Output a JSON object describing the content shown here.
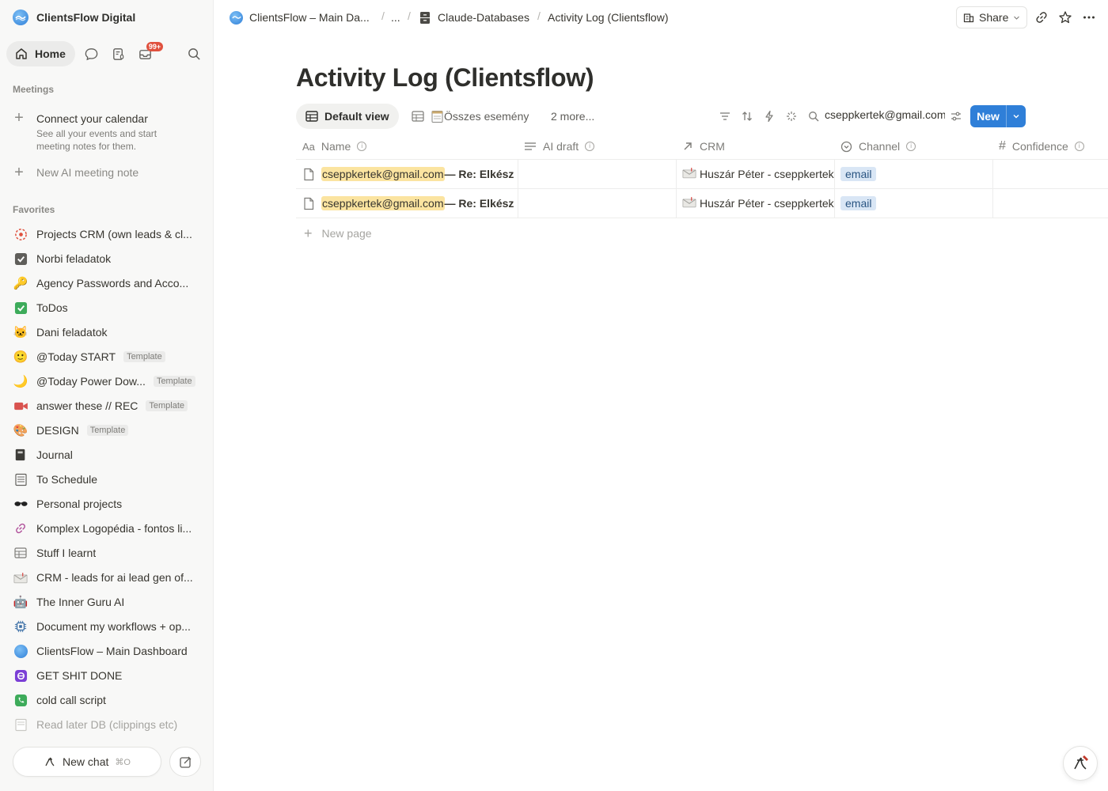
{
  "workspace": {
    "name": "ClientsFlow Digital"
  },
  "nav": {
    "home_label": "Home",
    "inbox_badge": "99+"
  },
  "meetings": {
    "section_label": "Meetings",
    "connect_title": "Connect your calendar",
    "connect_sub": "See all your events and start meeting notes for them.",
    "new_note": "New AI meeting note"
  },
  "favorites": {
    "section_label": "Favorites",
    "items": [
      {
        "label": "Projects CRM (own leads & cl...",
        "icon": "target-icon",
        "template": ""
      },
      {
        "label": "Norbi feladatok",
        "icon": "checkbox-icon",
        "template": ""
      },
      {
        "label": "Agency Passwords and Acco...",
        "icon": "key-icon",
        "template": ""
      },
      {
        "label": "ToDos",
        "icon": "check-mark-icon",
        "template": ""
      },
      {
        "label": "Dani feladatok",
        "icon": "cat-icon",
        "template": ""
      },
      {
        "label": "@Today START",
        "icon": "smile-icon",
        "template": "Template"
      },
      {
        "label": "@Today Power Dow...",
        "icon": "moon-icon",
        "template": "Template"
      },
      {
        "label": "answer these // REC",
        "icon": "video-camera-icon",
        "template": "Template"
      },
      {
        "label": "DESIGN",
        "icon": "palette-icon",
        "template": "Template"
      },
      {
        "label": "Journal",
        "icon": "notebook-icon",
        "template": ""
      },
      {
        "label": "To Schedule",
        "icon": "ledger-icon",
        "template": ""
      },
      {
        "label": "Personal projects",
        "icon": "sunglasses-icon",
        "template": ""
      },
      {
        "label": "Komplex Logopédia - fontos li...",
        "icon": "link-icon",
        "template": ""
      },
      {
        "label": "Stuff I learnt",
        "icon": "table-icon",
        "template": ""
      },
      {
        "label": "CRM - leads for ai lead gen of...",
        "icon": "envelope-icon",
        "template": ""
      },
      {
        "label": "The Inner Guru AI",
        "icon": "robot-icon",
        "template": ""
      },
      {
        "label": "Document my workflows + op...",
        "icon": "chip-icon",
        "template": ""
      },
      {
        "label": "ClientsFlow – Main Dashboard",
        "icon": "clientsflow-logo-icon",
        "template": ""
      },
      {
        "label": "GET SHIT DONE",
        "icon": "purple-badge-icon",
        "template": ""
      },
      {
        "label": "cold call script",
        "icon": "phone-icon",
        "template": ""
      },
      {
        "label": "Read later DB (clippings etc)",
        "icon": "document-icon",
        "template": ""
      }
    ]
  },
  "bottom": {
    "new_chat": "New chat",
    "shortcut": "⌘O"
  },
  "breadcrumbs": {
    "root": "ClientsFlow – Main Da...",
    "ellipsis": "...",
    "parent": "Claude-Databases",
    "current": "Activity Log (Clientsflow)",
    "separator": "/"
  },
  "topbar": {
    "share_label": "Share"
  },
  "page": {
    "title": "Activity Log (Clientsflow)"
  },
  "views": {
    "default": "Default view",
    "second": "Összes esemény",
    "more": "2 more...",
    "search_value": "cseppkertek@gmail.com",
    "new_label": "New"
  },
  "table": {
    "columns": [
      "Name",
      "AI draft",
      "CRM",
      "Channel",
      "Confidence"
    ],
    "rows": [
      {
        "name_highlight": "cseppkertek@gmail.com",
        "name_rest": " — Re: Elkész",
        "ai_draft": "",
        "crm": "Huszár Péter - cseppkertek",
        "channel": "email",
        "confidence": ""
      },
      {
        "name_highlight": "cseppkertek@gmail.com",
        "name_rest": " — Re: Elkész",
        "ai_draft": "",
        "crm": "Huszár Péter - cseppkertek",
        "channel": "email",
        "confidence": ""
      }
    ],
    "new_page": "New page"
  },
  "colors": {
    "accent": "#2f7fd8",
    "highlight": "#fbe4a0",
    "chip": "#d9e6f5",
    "badge": "#e0513e"
  }
}
